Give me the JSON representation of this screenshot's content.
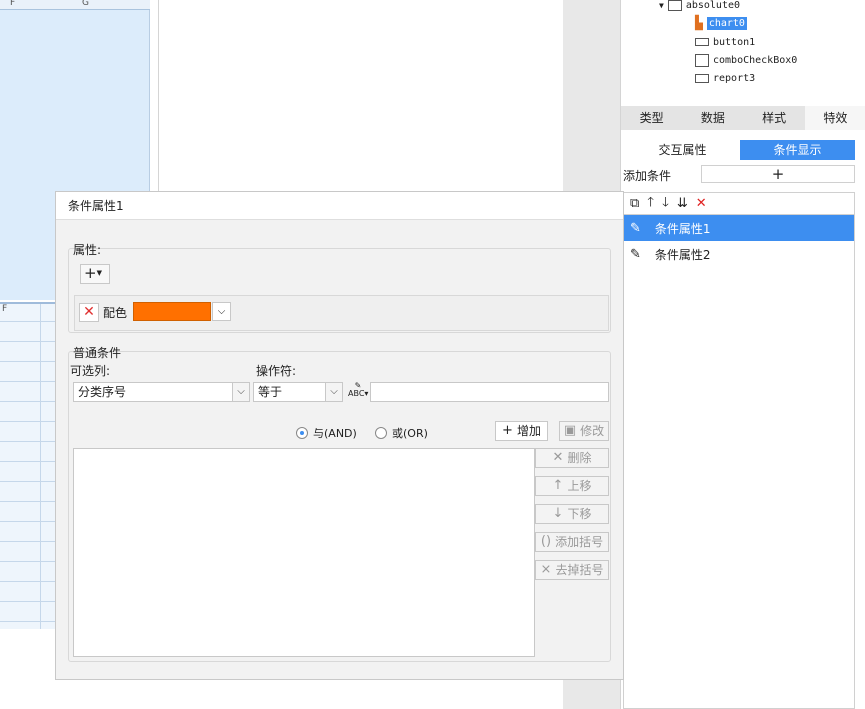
{
  "sheet": {
    "top_columns": [
      "F",
      "G"
    ],
    "bottom_columns": [
      "F"
    ]
  },
  "tree": {
    "items": [
      {
        "label": "absolute0"
      },
      {
        "label": "chart0"
      },
      {
        "label": "button1"
      },
      {
        "label": "comboCheckBox0"
      },
      {
        "label": "report3"
      }
    ]
  },
  "panel": {
    "tabs": [
      "类型",
      "数据",
      "样式",
      "特效"
    ],
    "subtabs": [
      "交互属性",
      "条件显示"
    ],
    "add_condition_label": "添加条件",
    "add_condition_btn": "+",
    "toolbar_icons": [
      "copy-icon",
      "arrow-up-icon",
      "arrow-down-icon",
      "move-bottom-icon",
      "delete-icon"
    ],
    "conditions": [
      "条件属性1",
      "条件属性2"
    ]
  },
  "dialog": {
    "title": "条件属性1",
    "attr_group_label": "属性:",
    "add_attr_btn": "+",
    "attr_name": "配色",
    "attr_color": "#ff7000",
    "common_group_label": "普通条件",
    "column_label": "可选列:",
    "column_value": "分类序号",
    "operator_label": "操作符:",
    "operator_value": "等于",
    "value_input": "",
    "radio_and": "与(AND)",
    "radio_or": "或(OR)",
    "btn_add": "增加",
    "btn_modify": "修改",
    "btn_delete": "删除",
    "btn_up": "上移",
    "btn_down": "下移",
    "btn_add_paren": "添加括号",
    "btn_remove_paren": "去掉括号"
  }
}
